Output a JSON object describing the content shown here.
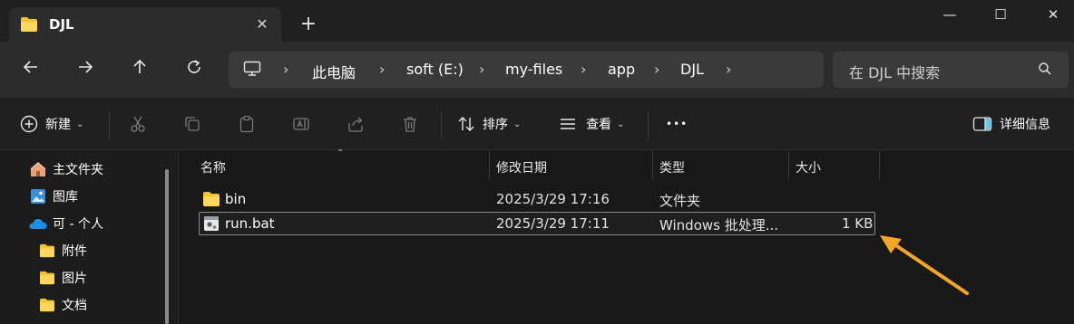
{
  "tab": {
    "title": "DJL",
    "close": "✕",
    "new_tab": "+"
  },
  "window": {
    "minimize": "—",
    "maximize": "☐",
    "close": "✕"
  },
  "breadcrumb": {
    "items": [
      "此电脑",
      "soft (E:)",
      "my-files",
      "app",
      "DJL"
    ],
    "separator": "›"
  },
  "search": {
    "placeholder": "在 DJL 中搜索"
  },
  "command_bar": {
    "new_label": "新建",
    "sort_label": "排序",
    "view_label": "查看",
    "more_label": "•••",
    "details_label": "详细信息"
  },
  "sidebar": {
    "items": [
      {
        "label": "主文件夹",
        "icon": "home-icon"
      },
      {
        "label": "图库",
        "icon": "gallery-icon"
      },
      {
        "label": "可 - 个人",
        "icon": "onedrive-cloud-icon"
      },
      {
        "label": "附件",
        "icon": "folder-icon"
      },
      {
        "label": "图片",
        "icon": "folder-icon"
      },
      {
        "label": "文档",
        "icon": "folder-icon"
      }
    ]
  },
  "columns": {
    "name": "名称",
    "modified": "修改日期",
    "type": "类型",
    "size": "大小"
  },
  "files": [
    {
      "name": "bin",
      "modified": "2025/3/29 17:16",
      "type": "文件夹",
      "size": "",
      "icon": "folder-icon"
    },
    {
      "name": "run.bat",
      "modified": "2025/3/29 17:11",
      "type": "Windows 批处理...",
      "size": "1 KB",
      "icon": "batch-file-icon",
      "selected": true
    }
  ],
  "colors": {
    "accent_arrow": "#f5a623",
    "folder": "#f4c430",
    "background": "#191919"
  }
}
